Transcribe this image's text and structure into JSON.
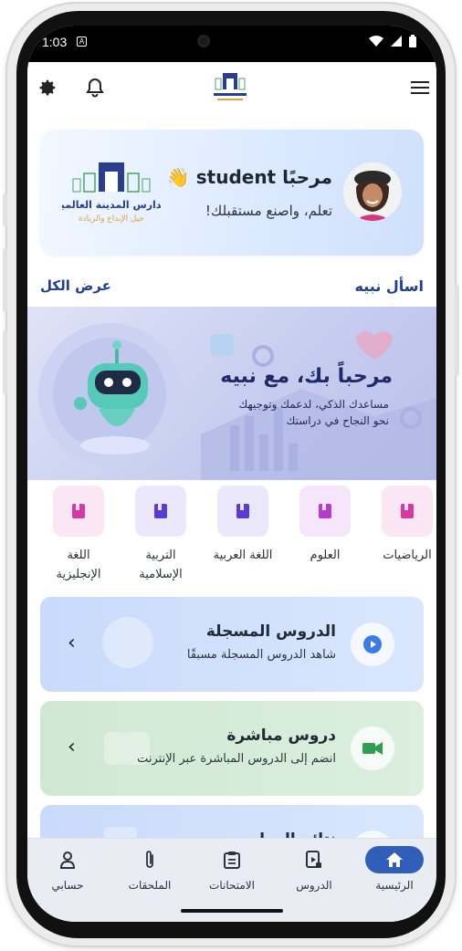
{
  "status_bar": {
    "time": "1:03",
    "badge": "A"
  },
  "app_bar": {
    "settings_icon": "gear-icon",
    "bell_icon": "bell-icon",
    "menu_icon": "hamburger-menu-icon",
    "logo": "school-logo"
  },
  "welcome": {
    "title": "مرحبًا student 👋",
    "subtitle": "تعلم، واصنع مستقبلك!",
    "logo": {
      "line1": "مدارس المدينة العالمية",
      "line2": "جيل الإبداع والريادة"
    }
  },
  "ask_section": {
    "title": "اسأل نبيه",
    "view_all": "عرض الكل"
  },
  "banner": {
    "title": "مرحباً بك، مع نبيه",
    "line1": "مساعدك الذكي، لدعمك وتوجيهك",
    "line2": "نحو النجاح في دراستك"
  },
  "subjects": [
    {
      "label": "الرياضيات",
      "color": "#d63aa0",
      "bg": "#fbe7f3"
    },
    {
      "label": "العلوم",
      "color": "#b53bd0",
      "bg": "#f6e6fb"
    },
    {
      "label": "اللغة العربية",
      "color": "#5b3bd6",
      "bg": "#ece8fb"
    },
    {
      "label_line1": "التربية",
      "label_line2": "الإسلامية",
      "color": "#5b3bd6",
      "bg": "#ece8fb"
    },
    {
      "label_line1": "اللغة",
      "label_line2": "الإنجليزية",
      "color": "#d63aa0",
      "bg": "#fbe7f3"
    }
  ],
  "cards": [
    {
      "title": "الدروس المسجلة",
      "subtitle": "شاهد الدروس المسجلة مسبقًا",
      "icon": "play-circle-icon",
      "accent": "#3b7be8",
      "bg": "#d7e6fd"
    },
    {
      "title": "دروس مباشرة",
      "subtitle": "انضم إلى الدروس المباشرة عبر الإنترنت",
      "icon": "video-camera-icon",
      "accent": "#2e9e4f",
      "bg": "#d9efdc"
    },
    {
      "title": "نتائج العمل",
      "icon": "file-icon",
      "accent": "#3b7be8",
      "bg": "#d7e6fd"
    }
  ],
  "bottom_nav": [
    {
      "label": "الرئيسية",
      "icon": "home-icon",
      "active": true
    },
    {
      "label": "الدروس",
      "icon": "lessons-icon"
    },
    {
      "label": "الامتحانات",
      "icon": "clipboard-icon"
    },
    {
      "label": "الملحقات",
      "icon": "paperclip-icon"
    },
    {
      "label": "حسابي",
      "icon": "person-icon"
    }
  ],
  "colors": {
    "primary": "#1f3f95",
    "active_nav": "#2f5fb9"
  }
}
